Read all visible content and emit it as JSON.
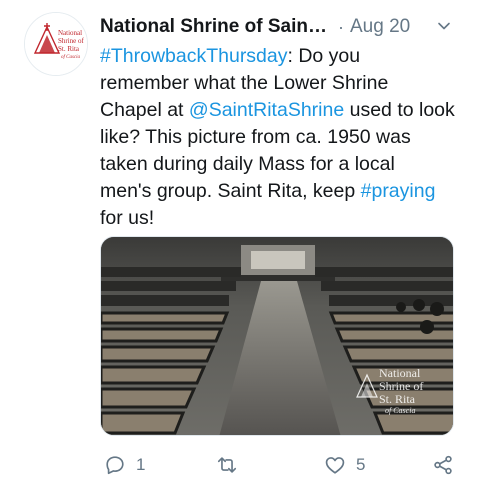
{
  "tweet": {
    "display_name": "National Shrine of Saint...",
    "separator": "·",
    "date": "Aug 20",
    "text_lines": [
      [
        {
          "t": "#ThrowbackThursday",
          "link": true
        },
        {
          "t": ": Do you",
          "link": false
        }
      ],
      [
        {
          "t": "remember what the Lower Shrine",
          "link": false
        }
      ],
      [
        {
          "t": "Chapel at ",
          "link": false
        },
        {
          "t": "@SaintRitaShrine",
          "link": true
        },
        {
          "t": " used to look",
          "link": false
        }
      ],
      [
        {
          "t": "like? This picture from ca. 1950 was",
          "link": false
        }
      ],
      [
        {
          "t": "taken during daily Mass for a local",
          "link": false
        }
      ],
      [
        {
          "t": "men's group. Saint Rita, keep ",
          "link": false
        },
        {
          "t": "#praying",
          "link": true
        }
      ],
      [
        {
          "t": " for us!",
          "link": false
        }
      ]
    ],
    "reply_count": "1",
    "retweet_count": "",
    "like_count": "5"
  },
  "avatar": {
    "line1": "National",
    "line2": "Shrine of",
    "line3": "St. Rita",
    "line4": "of Cascia"
  },
  "media": {
    "watermark_line1": "National",
    "watermark_line2": "Shrine of",
    "watermark_line3": "St. Rita",
    "watermark_line4": "of Cascia"
  },
  "colors": {
    "link": "#1b95e0",
    "meta": "#657786",
    "brand_red": "#c0262d"
  },
  "icons": {
    "caret": "chevron-down-icon",
    "reply": "reply-icon",
    "retweet": "retweet-icon",
    "like": "heart-icon",
    "share": "share-icon"
  }
}
